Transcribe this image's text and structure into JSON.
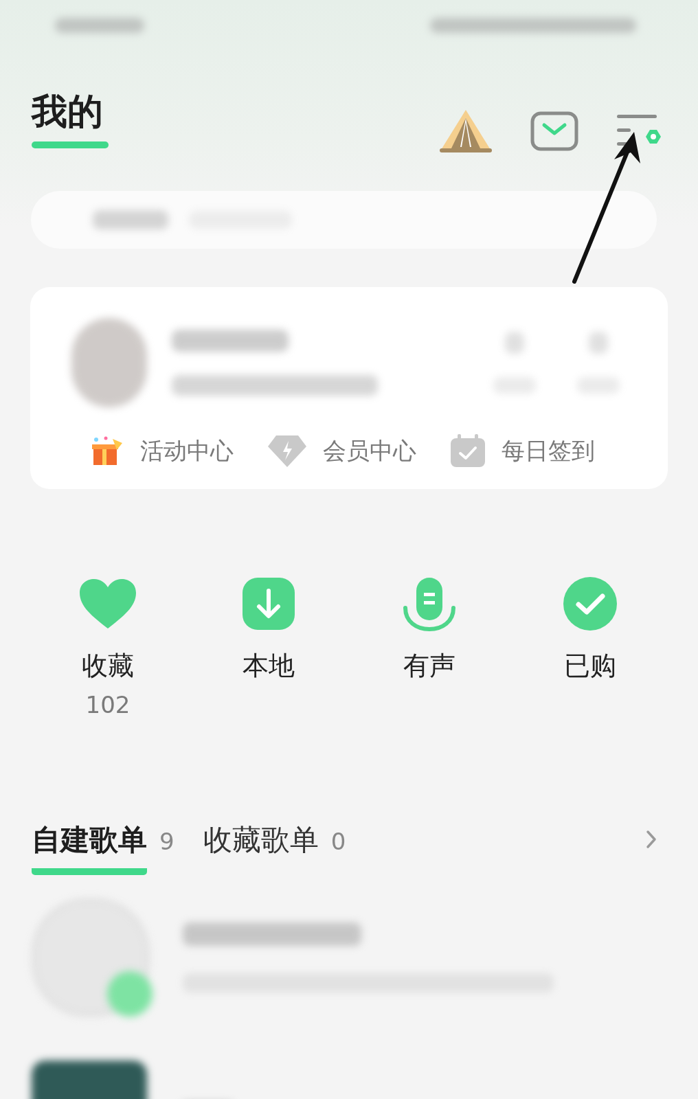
{
  "header": {
    "title": "我的"
  },
  "shortcuts": [
    {
      "label": "活动中心",
      "kind": "gift"
    },
    {
      "label": "会员中心",
      "kind": "diamond"
    },
    {
      "label": "每日签到",
      "kind": "calendar"
    }
  ],
  "quick_actions": [
    {
      "label": "收藏",
      "count": "102",
      "kind": "heart"
    },
    {
      "label": "本地",
      "kind": "download"
    },
    {
      "label": "有声",
      "kind": "mic"
    },
    {
      "label": "已购",
      "kind": "check"
    }
  ],
  "playlist_tabs": [
    {
      "label": "自建歌单",
      "count": "9",
      "selected": true
    },
    {
      "label": "收藏歌单",
      "count": "0",
      "selected": false
    }
  ]
}
